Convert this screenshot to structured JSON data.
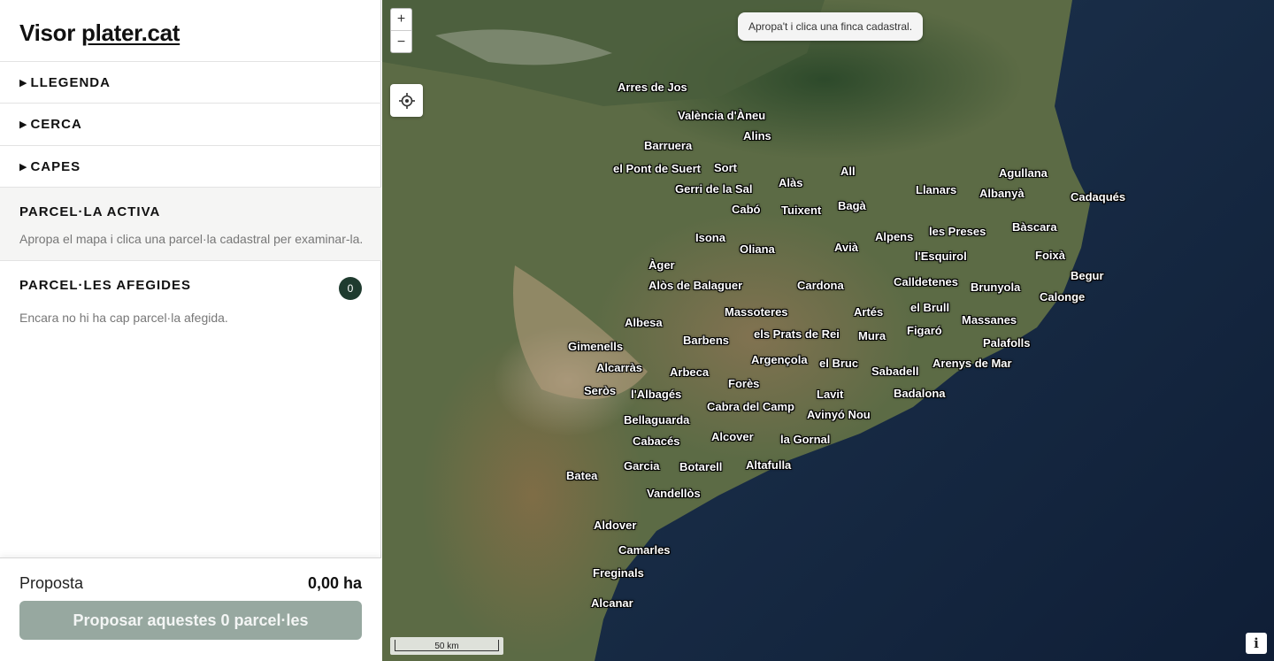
{
  "sidebar": {
    "title_prefix": "Visor",
    "title_link": "plater.cat",
    "sections": [
      {
        "label": "LLEGENDA"
      },
      {
        "label": "CERCA"
      },
      {
        "label": "CAPES"
      }
    ],
    "active_parcel": {
      "heading": "PARCEL·LA ACTIVA",
      "text": "Apropa el mapa i clica una parcel·la cadastral per examinar-la."
    },
    "added_parcels": {
      "heading": "PARCEL·LES AFEGIDES",
      "count": "0",
      "text": "Encara no hi ha cap parcel·la afegida."
    },
    "footer": {
      "label": "Proposta",
      "value": "0,00 ha",
      "button_label": "Proposar aquestes 0 parcel·les"
    }
  },
  "map": {
    "toast": "Apropa't i clica una finca cadastral.",
    "zoom_in": "+",
    "zoom_out": "−",
    "scale_label": "50 km",
    "info_label": "i",
    "place_labels": [
      "Arres de Jos",
      "València d'Àneu",
      "Alins",
      "Barruera",
      "el Pont de Suert",
      "Sort",
      "Gerri de la Sal",
      "Alàs",
      "All",
      "Agullana",
      "Llanars",
      "Albanyà",
      "Cadaqués",
      "Cabó",
      "Tuixent",
      "Bagà",
      "Isona",
      "Oliana",
      "Avià",
      "Alpens",
      "les Preses",
      "Bàscara",
      "l'Esquirol",
      "Foixà",
      "Àger",
      "Begur",
      "Alòs de Balaguer",
      "Cardona",
      "Calldetenes",
      "Brunyola",
      "Calonge",
      "Massoteres",
      "Artés",
      "el Brull",
      "Massanes",
      "Albesa",
      "Barbens",
      "els Prats de Rei",
      "Mura",
      "Figaró",
      "Palafolls",
      "Gimenells",
      "Argençola",
      "el Bruc",
      "Sabadell",
      "Arenys de Mar",
      "Alcarràs",
      "Arbeca",
      "Forès",
      "Seròs",
      "l'Albagés",
      "Lavit",
      "Badalona",
      "Cabra del Camp",
      "Bellaguarda",
      "Avinyó Nou",
      "Cabacés",
      "Alcover",
      "la Gornal",
      "Garcia",
      "Botarell",
      "Altafulla",
      "Batea",
      "Vandellòs",
      "Aldover",
      "Camarles",
      "Freginals",
      "Alcanar"
    ]
  }
}
